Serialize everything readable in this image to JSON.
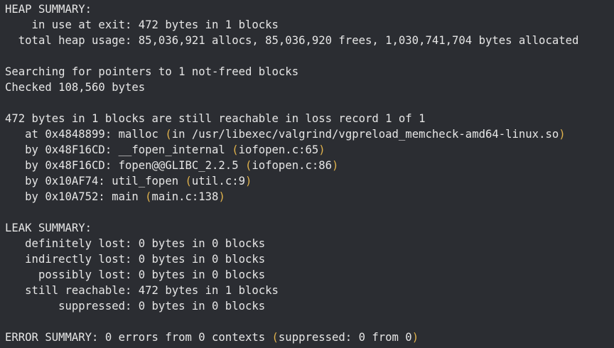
{
  "terminal": {
    "lines": [
      {
        "segments": [
          {
            "t": "HEAP SUMMARY:"
          }
        ]
      },
      {
        "segments": [
          {
            "t": "    in use at exit: 472 bytes in 1 blocks"
          }
        ]
      },
      {
        "segments": [
          {
            "t": "  total heap usage: 85,036,921 allocs, 85,036,920 frees, 1,030,741,704 bytes allocated"
          }
        ]
      },
      {
        "segments": [
          {
            "t": ""
          }
        ]
      },
      {
        "segments": [
          {
            "t": "Searching for pointers to 1 not-freed blocks"
          }
        ]
      },
      {
        "segments": [
          {
            "t": "Checked 108,560 bytes"
          }
        ]
      },
      {
        "segments": [
          {
            "t": ""
          }
        ]
      },
      {
        "segments": [
          {
            "t": "472 bytes in 1 blocks are still reachable in loss record 1 of 1"
          }
        ]
      },
      {
        "segments": [
          {
            "t": "   at 0x4848899: malloc "
          },
          {
            "t": "(",
            "paren": true
          },
          {
            "t": "in /usr/libexec/valgrind/vgpreload_memcheck-amd64-linux.so"
          },
          {
            "t": ")",
            "paren": true
          }
        ]
      },
      {
        "segments": [
          {
            "t": "   by 0x48F16CD: __fopen_internal "
          },
          {
            "t": "(",
            "paren": true
          },
          {
            "t": "iofopen.c:65"
          },
          {
            "t": ")",
            "paren": true
          }
        ]
      },
      {
        "segments": [
          {
            "t": "   by 0x48F16CD: fopen@@GLIBC_2.2.5 "
          },
          {
            "t": "(",
            "paren": true
          },
          {
            "t": "iofopen.c:86"
          },
          {
            "t": ")",
            "paren": true
          }
        ]
      },
      {
        "segments": [
          {
            "t": "   by 0x10AF74: util_fopen "
          },
          {
            "t": "(",
            "paren": true
          },
          {
            "t": "util.c:9"
          },
          {
            "t": ")",
            "paren": true
          }
        ]
      },
      {
        "segments": [
          {
            "t": "   by 0x10A752: main "
          },
          {
            "t": "(",
            "paren": true
          },
          {
            "t": "main.c:138"
          },
          {
            "t": ")",
            "paren": true
          }
        ]
      },
      {
        "segments": [
          {
            "t": ""
          }
        ]
      },
      {
        "segments": [
          {
            "t": "LEAK SUMMARY:"
          }
        ]
      },
      {
        "segments": [
          {
            "t": "   definitely lost: 0 bytes in 0 blocks"
          }
        ]
      },
      {
        "segments": [
          {
            "t": "   indirectly lost: 0 bytes in 0 blocks"
          }
        ]
      },
      {
        "segments": [
          {
            "t": "     possibly lost: 0 bytes in 0 blocks"
          }
        ]
      },
      {
        "segments": [
          {
            "t": "   still reachable: 472 bytes in 1 blocks"
          }
        ]
      },
      {
        "segments": [
          {
            "t": "        suppressed: 0 bytes in 0 blocks"
          }
        ]
      },
      {
        "segments": [
          {
            "t": ""
          }
        ]
      },
      {
        "segments": [
          {
            "t": "ERROR SUMMARY: 0 errors from 0 contexts "
          },
          {
            "t": "(",
            "paren": true
          },
          {
            "t": "suppressed: 0 from 0"
          },
          {
            "t": ")",
            "paren": true
          }
        ]
      }
    ]
  },
  "colors": {
    "background": "#2b2d32",
    "text": "#e6e6e6",
    "paren": "#e0b24c"
  }
}
